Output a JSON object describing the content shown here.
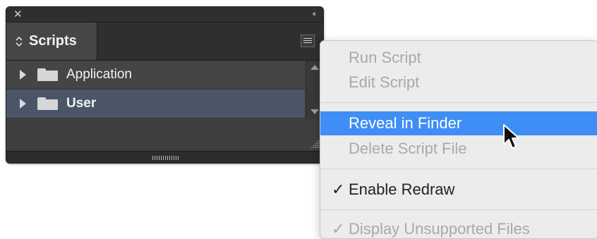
{
  "panel": {
    "close_glyph": "✕",
    "collapse_glyph": "‹‹",
    "tab": {
      "chevron_glyph": "◇",
      "label": "Scripts"
    },
    "rows": [
      {
        "label": "Application",
        "selected": false
      },
      {
        "label": "User",
        "selected": true
      }
    ]
  },
  "menu": {
    "items": [
      {
        "label": "Run Script",
        "enabled": false
      },
      {
        "label": "Edit Script",
        "enabled": false
      },
      {
        "label": "Reveal in Finder",
        "enabled": true,
        "highlighted": true
      },
      {
        "label": "Delete Script File",
        "enabled": false
      },
      {
        "label": "Enable Redraw",
        "enabled": true,
        "checked": true
      },
      {
        "label": "Display Unsupported Files",
        "enabled": false,
        "checked": true
      }
    ],
    "check_glyph": "✓"
  },
  "colors": {
    "panel_bg": "#3f3f3f",
    "selected_row": "#4a5668",
    "menu_bg": "#ececec",
    "menu_highlight": "#3f8ef5",
    "disabled_text": "#a9a9a9"
  },
  "icons": [
    "close-icon",
    "collapse-icon",
    "panel-menu-icon",
    "disclosure-triangle-icon",
    "folder-icon",
    "scroll-up-icon",
    "scroll-down-icon",
    "resize-grip-icon",
    "check-icon",
    "mouse-pointer-icon"
  ]
}
